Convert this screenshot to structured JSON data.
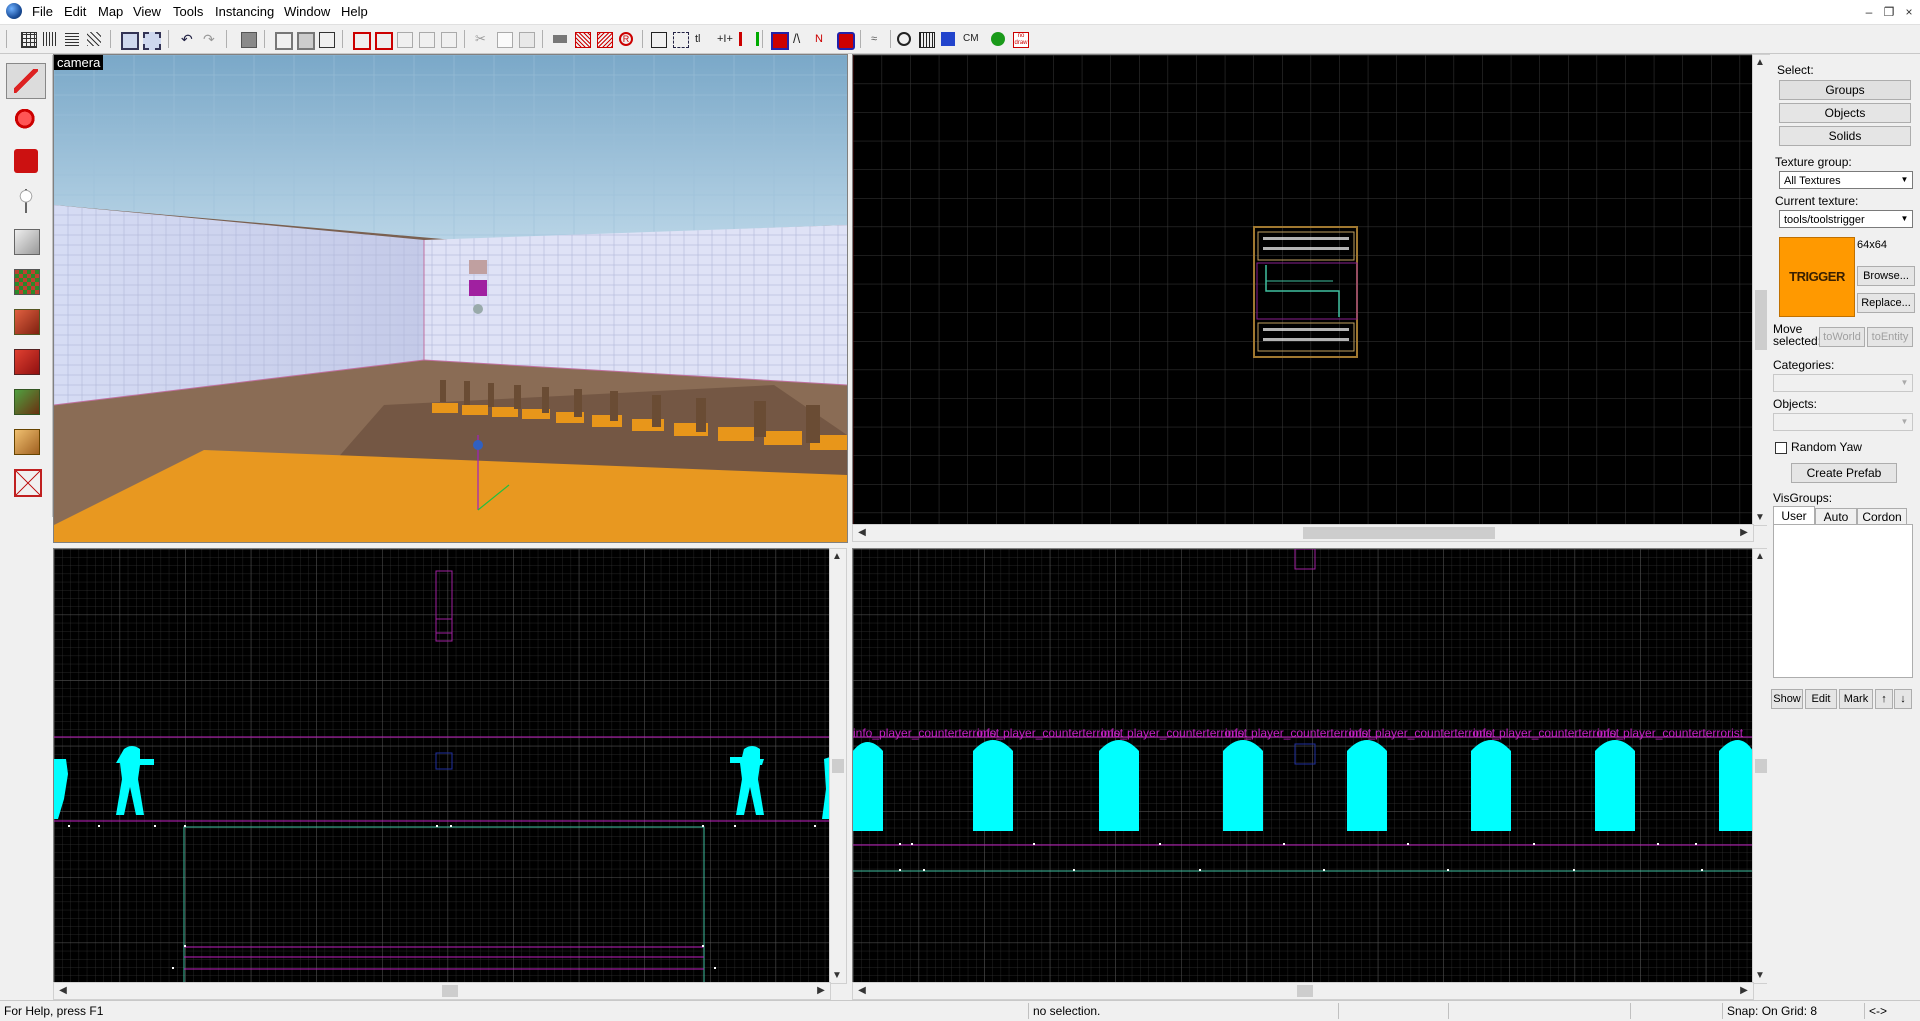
{
  "menu": [
    "File",
    "Edit",
    "Map",
    "View",
    "Tools",
    "Instancing",
    "Window",
    "Help"
  ],
  "window_controls": [
    "–",
    "❐",
    "×"
  ],
  "viewports": {
    "camera_label": "camera",
    "entity_label": "info_player_counterterrorist"
  },
  "right_panel": {
    "select_label": "Select:",
    "groups_label": "Groups",
    "objects_btn_label": "Objects",
    "solids_label": "Solids",
    "texture_group_label": "Texture group:",
    "texture_group_value": "All Textures",
    "current_texture_label": "Current texture:",
    "current_texture_value": "tools/toolstrigger",
    "texture_preview_text": "TRIGGER",
    "texture_size": "64x64",
    "browse_label": "Browse...",
    "replace_label": "Replace...",
    "move_selected_label": "Move selected:",
    "to_world_label": "toWorld",
    "to_entity_label": "toEntity",
    "categories_label": "Categories:",
    "objects_label": "Objects:",
    "random_yaw_label": "Random Yaw",
    "create_prefab_label": "Create Prefab",
    "visgroups_label": "VisGroups:",
    "visgroup_tabs": [
      "User",
      "Auto",
      "Cordon"
    ],
    "visgroup_buttons": [
      "Show",
      "Edit",
      "Mark",
      "↑",
      "↓"
    ]
  },
  "status": {
    "help": "For Help, press F1",
    "selection": "no selection.",
    "snap": "Snap: On Grid: 8",
    "arrows": "<->"
  },
  "colors": {
    "grid_line": "#3a3a3a",
    "grid_major": "#5a5a5a",
    "entity_cyan": "#00ffff",
    "brush_magenta": "#c020c0",
    "brush_teal": "#40c0a0",
    "trigger_orange": "#ff9900"
  }
}
